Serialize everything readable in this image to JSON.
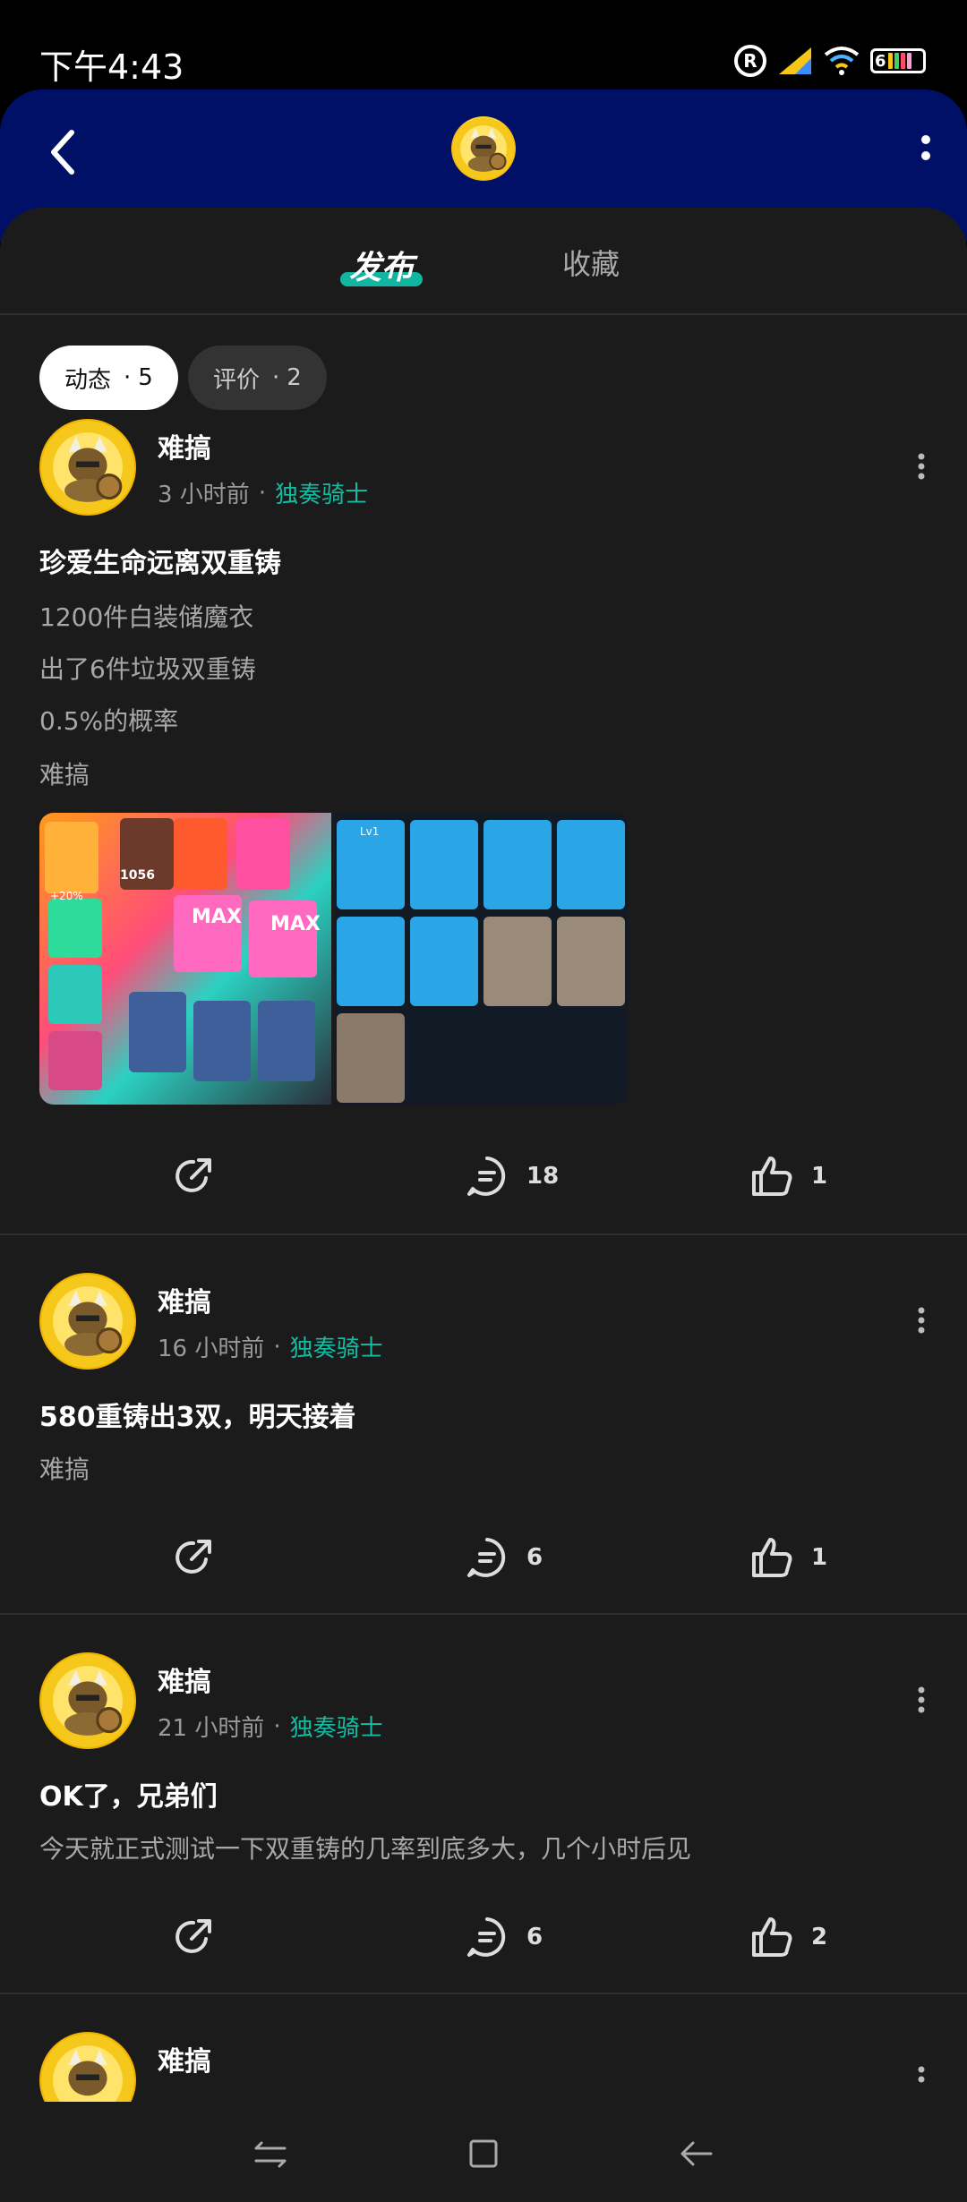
{
  "status_bar": {
    "time": "下午4:43",
    "registered_mark": "R",
    "battery_level": "6"
  },
  "header": {
    "back_icon": "chevron-left-icon",
    "more_icon": "more-vertical-icon"
  },
  "tabs": [
    {
      "label": "发布",
      "active": true
    },
    {
      "label": "收藏",
      "active": false
    }
  ],
  "filters": [
    {
      "label": "动态",
      "count": "5",
      "active": true
    },
    {
      "label": "评价",
      "count": "2",
      "active": false
    }
  ],
  "posts": [
    {
      "author": "难搞",
      "time": "3 小时前",
      "game": "独奏骑士",
      "title": "珍爱生命远离双重铸",
      "lines": [
        "1200件白装储魔衣",
        "出了6件垃圾双重铸",
        "0.5%的概率",
        "难搞"
      ],
      "has_images": true,
      "comments": "18",
      "likes": "1"
    },
    {
      "author": "难搞",
      "time": "16 小时前",
      "game": "独奏骑士",
      "title": "580重铸出3双，明天接着",
      "lines": [
        "难搞"
      ],
      "comments": "6",
      "likes": "1"
    },
    {
      "author": "难搞",
      "time": "21 小时前",
      "game": "独奏骑士",
      "title": "OK了，兄弟们",
      "lines": [
        "今天就正式测试一下双重铸的几率到底多大，几个小时后见"
      ],
      "comments": "6",
      "likes": "2"
    },
    {
      "author": "难搞"
    }
  ],
  "image_text": {
    "count": "1056",
    "max_label": "MAX",
    "percent": "+20%",
    "level": "Lv1"
  },
  "colors": {
    "accent": "#14bca2",
    "header_bg": "#001067",
    "sheet_bg": "#1b1b1b"
  },
  "nav_bar": {
    "icons": [
      "recents-icon",
      "home-icon",
      "back-arrow-icon"
    ]
  }
}
